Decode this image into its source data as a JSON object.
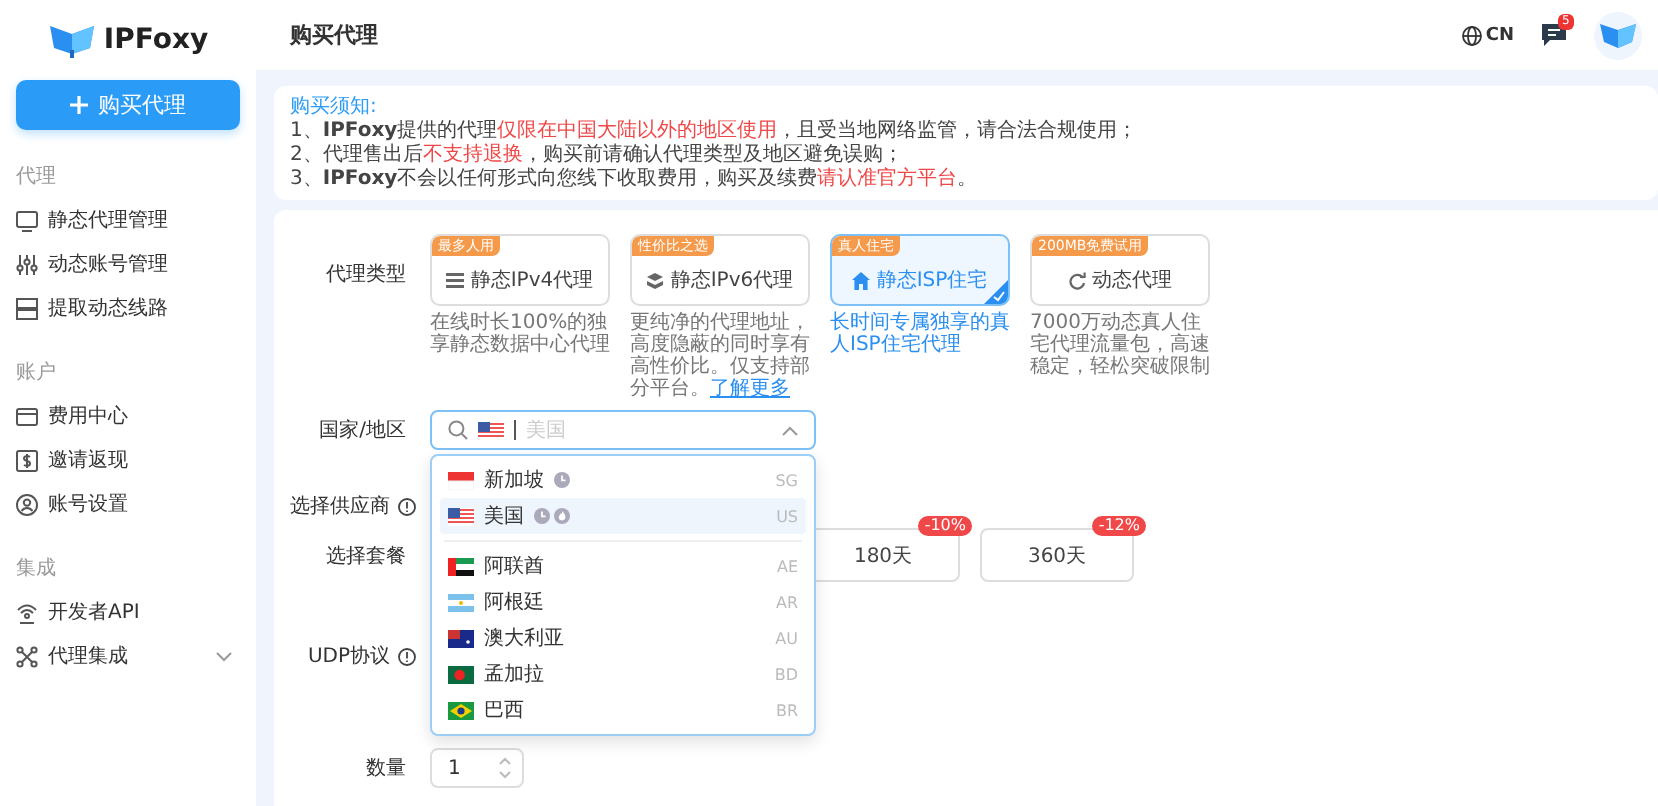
{
  "sidebar": {
    "logo": "IPFoxy",
    "buy_button": "购买代理",
    "sections": [
      {
        "title": "代理",
        "items": [
          {
            "label": "静态代理管理",
            "kind": "monitor"
          },
          {
            "label": "动态账号管理",
            "kind": "sliders"
          },
          {
            "label": "提取动态线路",
            "kind": "server"
          }
        ]
      },
      {
        "title": "账户",
        "items": [
          {
            "label": "费用中心",
            "kind": "card"
          },
          {
            "label": "邀请返现",
            "kind": "dollar"
          },
          {
            "label": "账号设置",
            "kind": "user"
          }
        ]
      },
      {
        "title": "集成",
        "items": [
          {
            "label": "开发者API",
            "kind": "api"
          },
          {
            "label": "代理集成",
            "kind": "nodes",
            "expanded": false
          }
        ]
      }
    ]
  },
  "header": {
    "title": "购买代理",
    "language": "CN",
    "notifications": "5"
  },
  "notice": {
    "title": "购买须知:",
    "lines": [
      [
        {
          "text": "1、**IPFoxy**提供的代理",
          "highlight": false
        },
        {
          "text": "仅限在中国大陆以外的地区使用",
          "highlight": true
        },
        {
          "text": "，且受当地网络监管，请合法合规使用；",
          "highlight": false
        }
      ],
      [
        {
          "text": "2、代理售出后",
          "highlight": false
        },
        {
          "text": "不支持退换",
          "highlight": true
        },
        {
          "text": "，购买前请确认代理类型及地区避免误购；",
          "highlight": false
        }
      ],
      [
        {
          "text": "3、**IPFoxy**不会以任何形式向您线下收取费用，购买及续费",
          "highlight": false
        },
        {
          "text": "请认准官方平台",
          "highlight": true
        },
        {
          "text": "。",
          "highlight": false
        }
      ]
    ]
  },
  "proxy_type": {
    "label": "代理类型",
    "options": [
      {
        "tag": "最多人用",
        "title": "静态IPv4代理",
        "kind": "server",
        "description": "在线时长100%的独享静态数据中心代理",
        "selected": false
      },
      {
        "tag": "性价比之选",
        "title": "静态IPv6代理",
        "kind": "cube",
        "description": "更纯净的代理地址，高度隐蔽的同时享有高性价比。仅支持部分平台。",
        "link": "了解更多",
        "selected": false
      },
      {
        "tag": "真人住宅",
        "title": "静态ISP住宅",
        "kind": "home",
        "description": "长时间专属独享的真人ISP住宅代理",
        "selected": true
      },
      {
        "tag": "200MB免费试用",
        "title": "动态代理",
        "kind": "refresh",
        "description": "7000万动态真人住宅代理流量包，高速稳定，轻松突破限制",
        "selected": false
      }
    ]
  },
  "country": {
    "label": "国家/地区",
    "kind": "us",
    "placeholder": "美国",
    "expanded": true,
    "recent": [
      {
        "name": "新加坡",
        "code": "SG",
        "kind": "sg",
        "popular": false,
        "selected": false
      },
      {
        "name": "美国",
        "code": "US",
        "kind": "us",
        "popular": true,
        "selected": true
      }
    ],
    "all": [
      {
        "name": "阿联酋",
        "code": "AE",
        "kind": "ae",
        "selected": false
      },
      {
        "name": "阿根廷",
        "code": "AR",
        "kind": "ar",
        "selected": false
      },
      {
        "name": "澳大利亚",
        "code": "AU",
        "kind": "au",
        "selected": false
      },
      {
        "name": "孟加拉",
        "code": "BD",
        "kind": "bd",
        "selected": false
      },
      {
        "name": "巴西",
        "code": "BR",
        "kind": "br",
        "selected": false
      }
    ]
  },
  "supplier": {
    "label": "选择供应商"
  },
  "package": {
    "label": "选择套餐",
    "options": [
      {
        "label": "180天",
        "discount": "-10%",
        "selected": false
      },
      {
        "label": "360天",
        "discount": "-12%",
        "selected": false
      }
    ]
  },
  "udp": {
    "label": "UDP协议"
  },
  "quantity": {
    "label": "数量",
    "value": "1"
  }
}
